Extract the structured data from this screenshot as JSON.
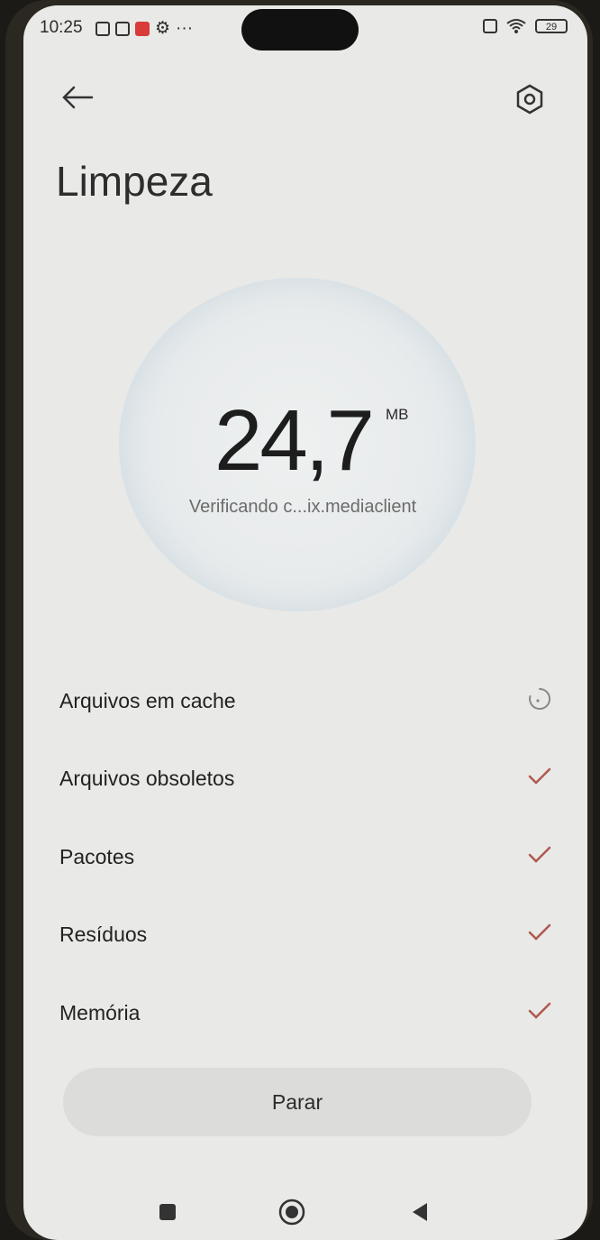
{
  "status_bar": {
    "time": "10:25",
    "battery": "29"
  },
  "header": {
    "back_icon": "arrow-left-icon",
    "settings_icon": "hexagon-settings-icon",
    "title": "Limpeza"
  },
  "scan": {
    "size_value": "24,7",
    "size_unit": "MB",
    "status_text": "Verificando c...ix.mediaclient"
  },
  "items": [
    {
      "label": "Arquivos em cache",
      "state": "scanning"
    },
    {
      "label": "Arquivos obsoletos",
      "state": "done"
    },
    {
      "label": "Pacotes",
      "state": "done"
    },
    {
      "label": "Resíduos",
      "state": "done"
    },
    {
      "label": "Memória",
      "state": "done"
    }
  ],
  "actions": {
    "stop_label": "Parar"
  },
  "navbar": {
    "recents_icon": "square-recents-icon",
    "home_icon": "circle-home-icon",
    "back_icon": "triangle-back-icon"
  },
  "colors": {
    "check": "#b0574f",
    "background": "#e9e9e7"
  }
}
